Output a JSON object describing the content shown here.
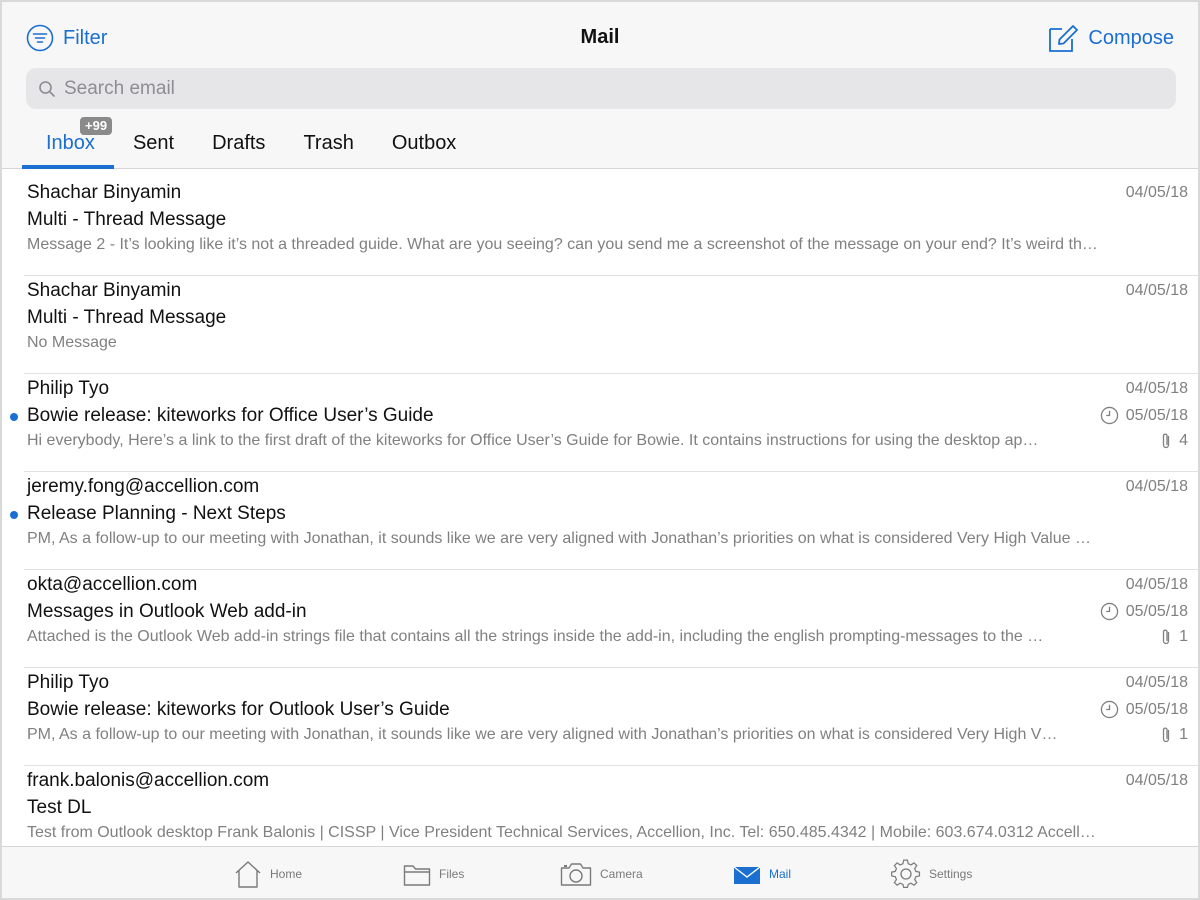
{
  "header": {
    "title": "Mail",
    "filter_label": "Filter",
    "compose_label": "Compose"
  },
  "search": {
    "placeholder": "Search email"
  },
  "tabs": [
    {
      "label": "Inbox",
      "badge": "+99",
      "active": true
    },
    {
      "label": "Sent"
    },
    {
      "label": "Drafts"
    },
    {
      "label": "Trash"
    },
    {
      "label": "Outbox"
    }
  ],
  "messages": [
    {
      "sender": "Shachar Binyamin",
      "subject": "Multi - Thread Message",
      "preview": "Message 2 - It’s looking like it’s not a threaded guide. What are you seeing? can you send me a screenshot of the message on your end? It’s weird th…",
      "date": "04/05/18",
      "unread": false
    },
    {
      "sender": "Shachar Binyamin",
      "subject": "Multi - Thread Message",
      "preview": "No Message",
      "date": "04/05/18",
      "unread": false
    },
    {
      "sender": "Philip Tyo",
      "subject": "Bowie release: kiteworks for Office User’s Guide",
      "preview": "Hi everybody, Here’s a link to the first draft of the kiteworks for Office User’s Guide for Bowie. It contains instructions for using the desktop ap…",
      "date": "04/05/18",
      "due": "05/05/18",
      "attachments": "4",
      "unread": true
    },
    {
      "sender": "jeremy.fong@accellion.com",
      "subject": "Release Planning - Next Steps",
      "preview": "PM, As a follow-up to our meeting with Jonathan, it sounds like we are very aligned with Jonathan’s priorities on what is considered Very High Value …",
      "date": "04/05/18",
      "unread": true
    },
    {
      "sender": "okta@accellion.com",
      "subject": "Messages in Outlook Web add-in",
      "preview": "Attached is the Outlook Web add-in strings file that contains all the strings inside the add-in, including the english prompting-messages to the …",
      "date": "04/05/18",
      "due": "05/05/18",
      "attachments": "1",
      "unread": false
    },
    {
      "sender": "Philip Tyo",
      "subject": "Bowie release: kiteworks for Outlook User’s Guide",
      "preview": "PM, As a follow-up to our meeting with Jonathan, it sounds like we are very aligned with Jonathan’s priorities on what is considered Very High V…",
      "date": "04/05/18",
      "due": "05/05/18",
      "attachments": "1",
      "unread": false
    },
    {
      "sender": "frank.balonis@accellion.com",
      "subject": "Test DL",
      "preview": "Test from Outlook desktop Frank Balonis | CISSP | Vice President Technical Services, Accellion, Inc. Tel: 650.485.4342 | Mobile: 603.674.0312 Accell…",
      "date": "04/05/18",
      "unread": false
    }
  ],
  "bottom_nav": [
    {
      "label": "Home",
      "icon": "home-icon"
    },
    {
      "label": "Files",
      "icon": "folder-icon"
    },
    {
      "label": "Camera",
      "icon": "camera-icon"
    },
    {
      "label": "Mail",
      "icon": "mail-icon",
      "active": true
    },
    {
      "label": "Settings",
      "icon": "gear-icon"
    }
  ],
  "colors": {
    "accent": "#1a6fd1",
    "muted_text": "#808080",
    "header_bg": "#f7f7f7",
    "badge_bg": "#8a8a8a"
  }
}
